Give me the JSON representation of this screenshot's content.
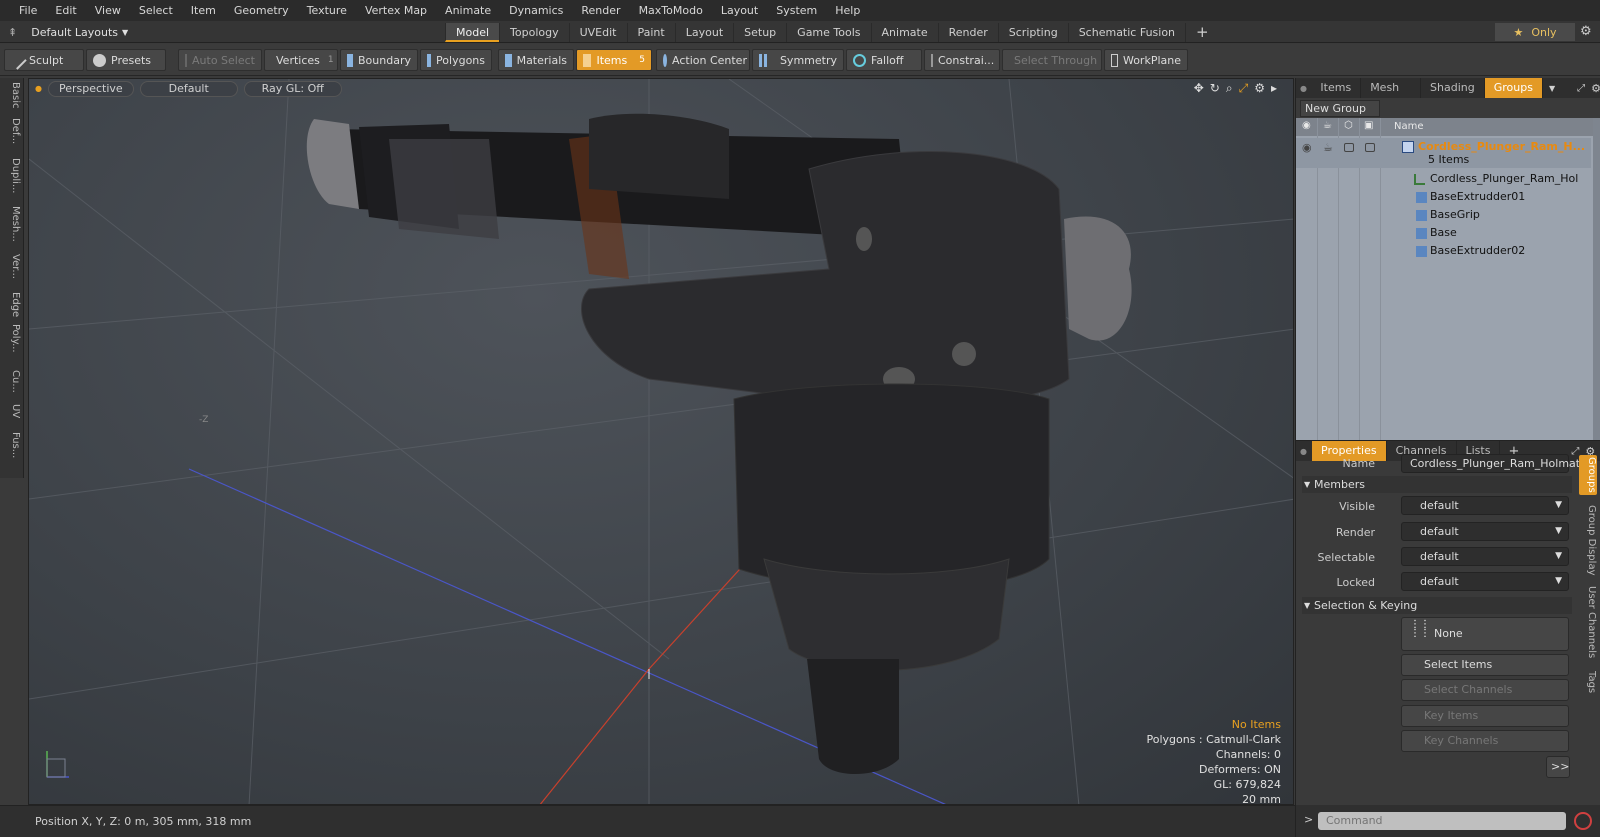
{
  "menu": [
    "File",
    "Edit",
    "View",
    "Select",
    "Item",
    "Geometry",
    "Texture",
    "Vertex Map",
    "Animate",
    "Dynamics",
    "Render",
    "MaxToModo",
    "Layout",
    "System",
    "Help"
  ],
  "layout": {
    "selector": "Default Layouts",
    "tabs": [
      "Model",
      "Topology",
      "UVEdit",
      "Paint",
      "Layout",
      "Setup",
      "Game Tools",
      "Animate",
      "Render",
      "Scripting",
      "Schematic Fusion"
    ],
    "active_tab": "Model",
    "only_label": "Only"
  },
  "toolbar": {
    "sculpt": "Sculpt",
    "presets": "Presets",
    "auto_select": "Auto Select",
    "vertices": "Vertices",
    "vertices_count": "1",
    "boundary": "Boundary",
    "polygons": "Polygons",
    "materials": "Materials",
    "items": "Items",
    "items_count": "5",
    "action_center": "Action Center",
    "symmetry": "Symmetry",
    "falloff": "Falloff",
    "constraints": "Constrai...",
    "select_through": "Select Through",
    "workplane": "WorkPlane"
  },
  "left_tabs": [
    "Basic",
    "Def...",
    "Dupli...",
    "Mesh...",
    "Ver...",
    "Edge",
    "Poly...",
    "Cu...",
    "UV",
    "Fus..."
  ],
  "viewport": {
    "view": "Perspective",
    "shading": "Default",
    "raygl": "Ray GL: Off",
    "axis_label": "-Z",
    "stats": {
      "selection": "No Items",
      "polygons": "Polygons : Catmull-Clark",
      "channels": "Channels: 0",
      "deformers": "Deformers: ON",
      "gl": "GL: 679,824",
      "scale": "20 mm"
    }
  },
  "status": {
    "position": "Position X, Y, Z:   0 m, 305 mm, 318 mm"
  },
  "groups_panel": {
    "tabs": [
      "Items",
      "Mesh ...",
      "Shading",
      "Groups"
    ],
    "active_tab": "Groups",
    "new_group": "New Group",
    "name_header": "Name",
    "tree": [
      {
        "label": "Cordless_Plunger_Ram_H...",
        "sub": "5 Items",
        "type": "group"
      },
      {
        "label": "Cordless_Plunger_Ram_Hol ...",
        "type": "locator"
      },
      {
        "label": "BaseExtrudder01",
        "type": "mesh"
      },
      {
        "label": "BaseGrip",
        "type": "mesh"
      },
      {
        "label": "Base",
        "type": "mesh"
      },
      {
        "label": "BaseExtrudder02",
        "type": "mesh"
      }
    ]
  },
  "properties_panel": {
    "tabs": [
      "Properties",
      "Channels",
      "Lists"
    ],
    "active_tab": "Properties",
    "name_label": "Name",
    "name_value": "Cordless_Plunger_Ram_Holmatro",
    "members_section": "Members",
    "fields": [
      {
        "label": "Visible",
        "value": "default"
      },
      {
        "label": "Render",
        "value": "default"
      },
      {
        "label": "Selectable",
        "value": "default"
      },
      {
        "label": "Locked",
        "value": "default"
      }
    ],
    "selection_section": "Selection & Keying",
    "none_btn": "None",
    "select_items": "Select Items",
    "select_channels": "Select Channels",
    "key_items": "Key Items",
    "key_channels": "Key Channels",
    "more": ">>",
    "side_tabs": [
      "Groups",
      "Group Display",
      "User Channels",
      "Tags"
    ]
  },
  "command": {
    "placeholder": "Command"
  },
  "colors": {
    "accent": "#e39a26",
    "tree_bg": "#9ba3ae"
  }
}
